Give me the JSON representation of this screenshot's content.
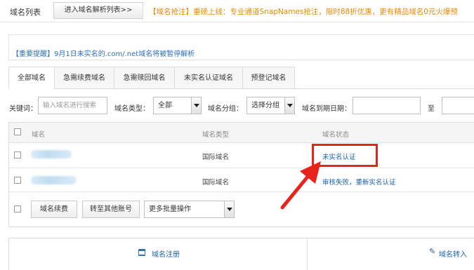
{
  "topbar": {
    "title": "域名列表",
    "enter_button": "进入域名解析列表>>",
    "promo": "【域名抢注】重磅上线：专业通道SnapNames抢注，限时88折优惠，更有精品域名0元火爆预"
  },
  "notice": "【重要提醒】9月1日未实名的.com/.net域名将被暂停解析",
  "tabs": [
    "全部域名",
    "急需续费域名",
    "急需赎回域名",
    "未实名认证域名",
    "预登记域名"
  ],
  "filters": {
    "keyword_label": "关键词：",
    "keyword_placeholder": "输入域名进行搜索",
    "type_label": "域名类型：",
    "type_value": "全部",
    "group_label": "域名分组：",
    "group_value": "选择分组",
    "expire_label": "域名到期日期：",
    "to_label": "至"
  },
  "table": {
    "headers": {
      "name": "域名",
      "type": "域名类型",
      "status": "域名状态"
    },
    "rows": [
      {
        "type": "国际域名",
        "status": "未实名认证"
      },
      {
        "type": "国际域名",
        "status": "审核失败，重新实名认证"
      }
    ],
    "actions": {
      "renew": "域名续费",
      "transfer": "转至其他账号",
      "more": "更多批量操作"
    }
  },
  "bottom": {
    "register": "域名注册",
    "transfer_in": "域名转入"
  },
  "colors": {
    "highlight": "#e8231b",
    "link": "#1a62ae",
    "promo": "#e88a00"
  },
  "icons": [
    "calendar-icon",
    "pencil-icon",
    "red-arrow"
  ]
}
